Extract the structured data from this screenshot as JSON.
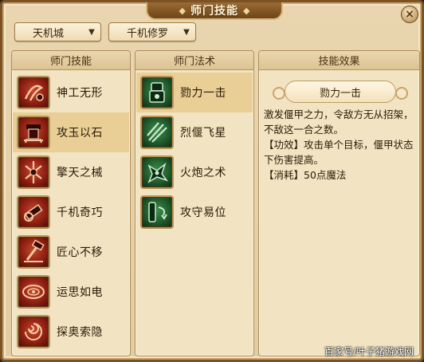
{
  "window": {
    "title": "师门技能",
    "close_label": "×"
  },
  "filters": {
    "city": {
      "value": "天机城"
    },
    "school": {
      "value": "千机修罗"
    }
  },
  "left_panel": {
    "header": "师门技能",
    "skills": [
      {
        "name": "神工无形",
        "icon": "craft-spiral-icon",
        "selected": false
      },
      {
        "name": "攻玉以石",
        "icon": "stone-mech-icon",
        "selected": true
      },
      {
        "name": "擎天之械",
        "icon": "pillar-mech-icon",
        "selected": false
      },
      {
        "name": "千机奇巧",
        "icon": "gear-hammer-icon",
        "selected": false
      },
      {
        "name": "匠心不移",
        "icon": "hammer-anvil-icon",
        "selected": false
      },
      {
        "name": "运思如电",
        "icon": "vortex-eye-icon",
        "selected": false
      },
      {
        "name": "探奥索隐",
        "icon": "dark-swirl-icon",
        "selected": false
      }
    ]
  },
  "mid_panel": {
    "header": "师门法术",
    "spells": [
      {
        "name": "勠力一击",
        "icon": "armor-strike-icon",
        "selected": true
      },
      {
        "name": "烈偃飞星",
        "icon": "claw-slash-icon",
        "selected": false
      },
      {
        "name": "火炮之术",
        "icon": "cannon-beast-icon",
        "selected": false
      },
      {
        "name": "攻守易位",
        "icon": "swap-stance-icon",
        "selected": false
      }
    ]
  },
  "right_panel": {
    "header": "技能效果",
    "skill_title": "勠力一击",
    "description": "激发偃甲之力，令敌方无从招架，不敌这一合之数。",
    "effect_line": "【功效】攻击单个目标，偃甲状态下伤害提高。",
    "cost_line": "【消耗】50点魔法"
  },
  "watermark": "百家号/叶子猪游戏网",
  "colors": {
    "frame": "#7a5225",
    "panel_bg": "#f2e3c2",
    "selected_row": "#e9cf96",
    "skill_icon_bg": "#8e1f12",
    "spell_icon_bg": "#1f5a2b"
  }
}
